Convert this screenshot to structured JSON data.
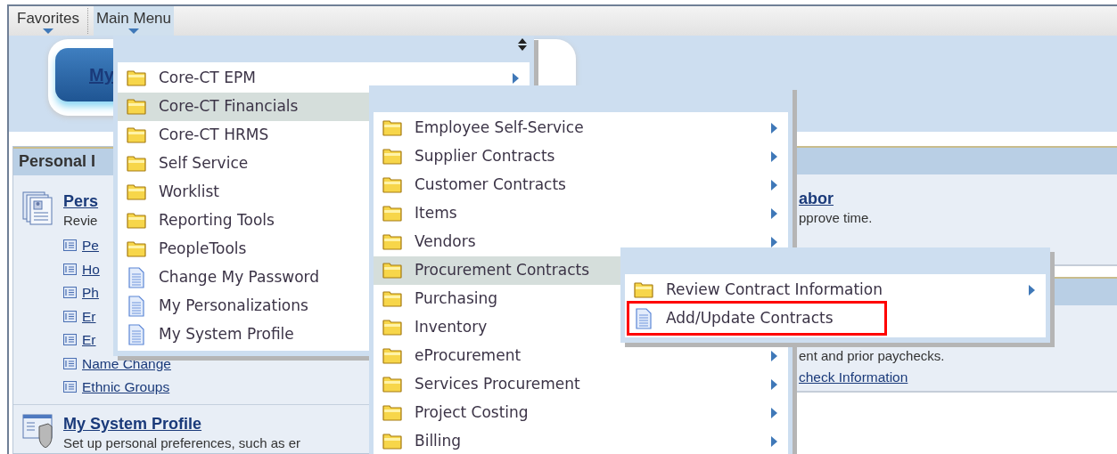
{
  "nav": [
    {
      "label": "Favorites",
      "selected": false
    },
    {
      "label": "Main Menu",
      "selected": true
    }
  ],
  "banner_button": "My",
  "left_pagelet": {
    "title": "Personal I",
    "sections": [
      {
        "title": "Pers",
        "description": "Revie",
        "links": [
          "Pe",
          "Ho",
          "Ph",
          "Er",
          "Er",
          "Name Change",
          "Ethnic Groups"
        ]
      },
      {
        "title": "My System Profile",
        "description": "Set up personal preferences, such as er"
      }
    ]
  },
  "right_pagelets": [
    {
      "title_link": "abor",
      "description": "pprove time."
    },
    {
      "description": "ent and prior paychecks.",
      "links": [
        "check Information"
      ]
    }
  ],
  "menus": [
    {
      "sortable": true,
      "items": [
        {
          "label": "Core-CT EPM",
          "kind": "folder",
          "has_submenu": true,
          "selected": false
        },
        {
          "label": "Core-CT Financials",
          "kind": "folder",
          "selected": true
        },
        {
          "label": "Core-CT HRMS",
          "kind": "folder",
          "selected": false
        },
        {
          "label": "Self Service",
          "kind": "folder",
          "selected": false
        },
        {
          "label": "Worklist",
          "kind": "folder",
          "selected": false
        },
        {
          "label": "Reporting Tools",
          "kind": "folder",
          "selected": false
        },
        {
          "label": "PeopleTools",
          "kind": "folder",
          "selected": false
        },
        {
          "label": "Change My Password",
          "kind": "page",
          "selected": false
        },
        {
          "label": "My Personalizations",
          "kind": "page",
          "selected": false
        },
        {
          "label": "My System Profile",
          "kind": "page",
          "selected": false
        }
      ]
    },
    {
      "sortable": false,
      "items": [
        {
          "label": "Employee Self-Service",
          "kind": "folder",
          "has_submenu": true,
          "selected": false
        },
        {
          "label": "Supplier Contracts",
          "kind": "folder",
          "has_submenu": true,
          "selected": false
        },
        {
          "label": "Customer Contracts",
          "kind": "folder",
          "has_submenu": true,
          "selected": false
        },
        {
          "label": "Items",
          "kind": "folder",
          "has_submenu": true,
          "selected": false
        },
        {
          "label": "Vendors",
          "kind": "folder",
          "has_submenu": true,
          "selected": false
        },
        {
          "label": "Procurement Contracts",
          "kind": "folder",
          "selected": true
        },
        {
          "label": "Purchasing",
          "kind": "folder",
          "selected": false
        },
        {
          "label": "Inventory",
          "kind": "folder",
          "selected": false
        },
        {
          "label": "eProcurement",
          "kind": "folder",
          "has_submenu": true,
          "selected": false
        },
        {
          "label": "Services Procurement",
          "kind": "folder",
          "has_submenu": true,
          "selected": false
        },
        {
          "label": "Project Costing",
          "kind": "folder",
          "has_submenu": true,
          "selected": false
        },
        {
          "label": "Billing",
          "kind": "folder",
          "has_submenu": true,
          "selected": false
        }
      ]
    },
    {
      "sortable": false,
      "items": [
        {
          "label": "Review Contract Information",
          "kind": "folder",
          "has_submenu": true,
          "selected": false,
          "annotated": false
        },
        {
          "label": "Add/Update Contracts",
          "kind": "page",
          "selected": false,
          "annotated": true
        }
      ]
    }
  ]
}
